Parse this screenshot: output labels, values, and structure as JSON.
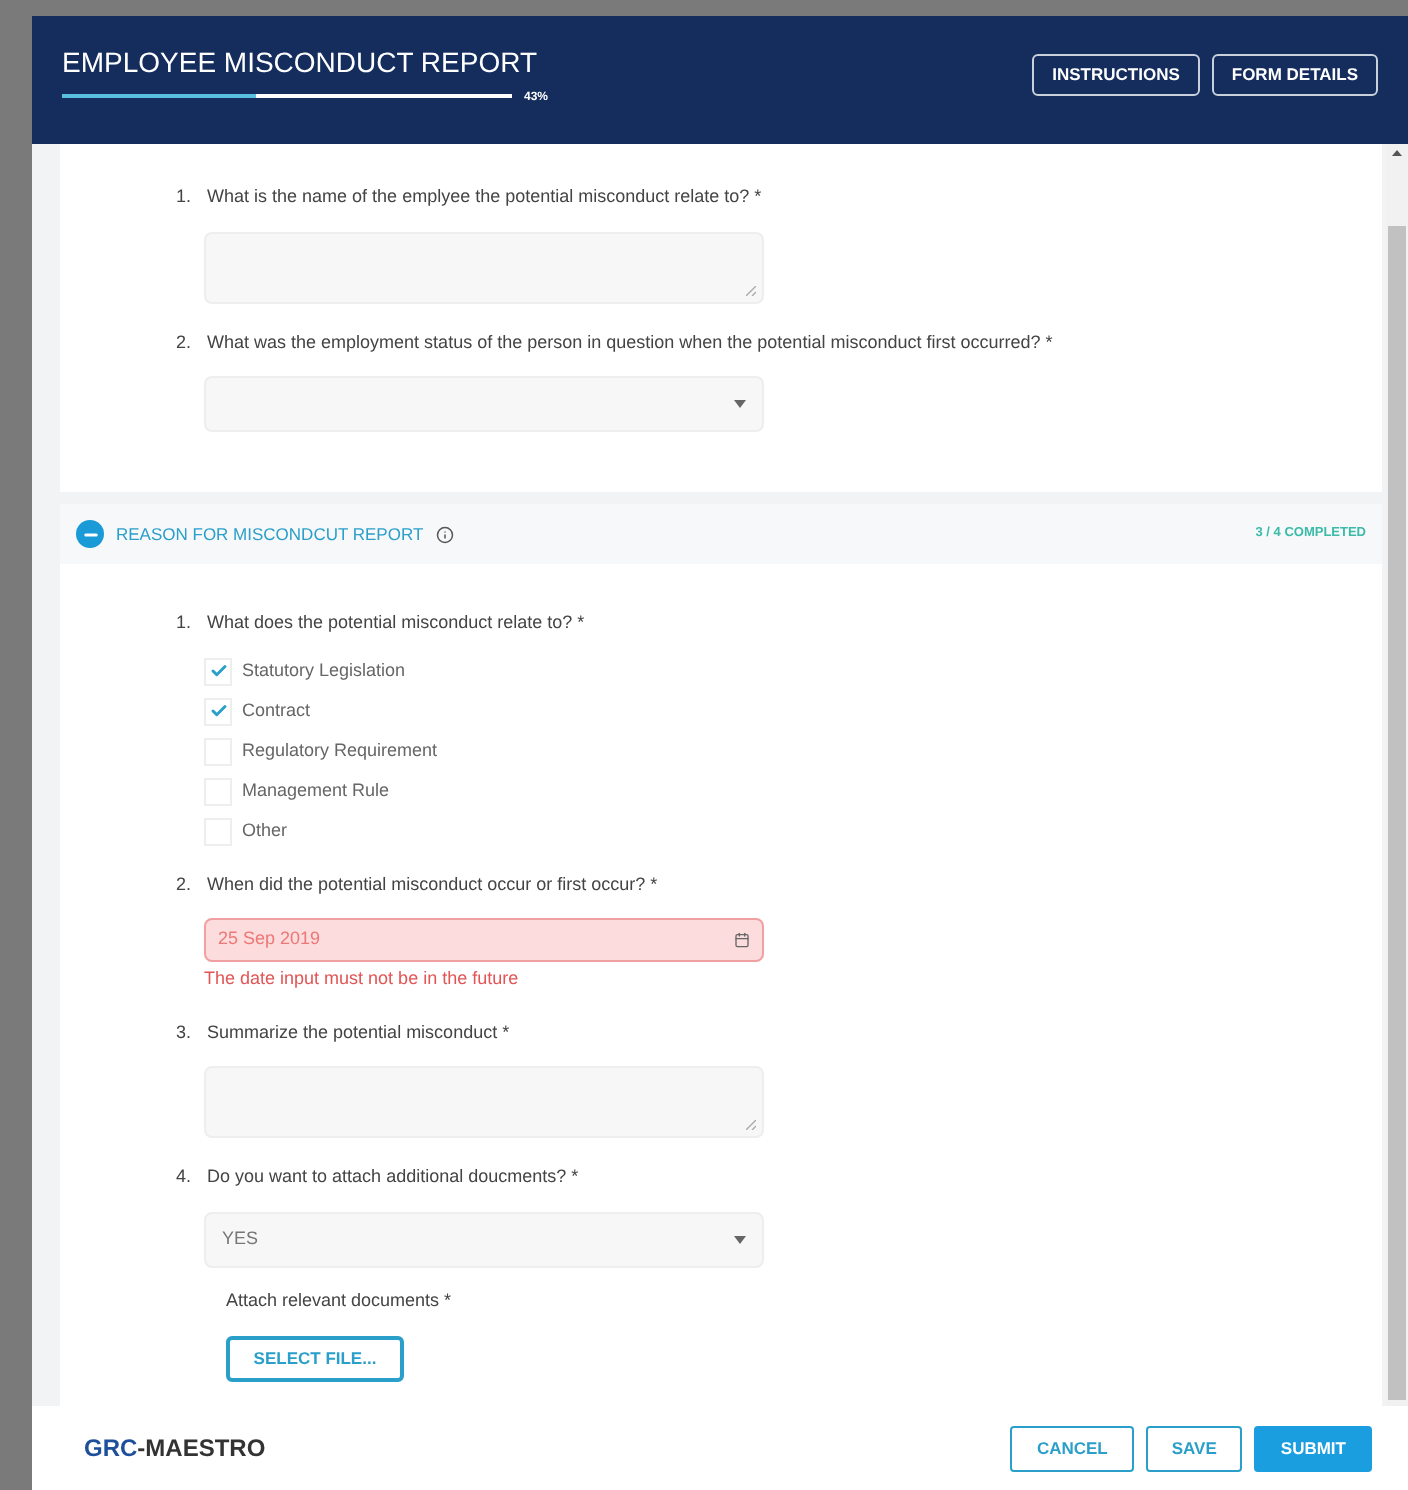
{
  "header": {
    "title": "EMPLOYEE MISCONDUCT REPORT",
    "progress": {
      "level": 0.43,
      "label": "43%"
    },
    "buttons": [
      "INSTRUCTIONS",
      "FORM DETAILS"
    ]
  },
  "sections": [
    {
      "questions": [
        {
          "number": "1.",
          "text": "What is the name of the emplyee the potential misconduct relate to? *",
          "kind": "textarea"
        },
        {
          "number": "2.",
          "text": "What was the employment status of the person in question when the potential misconduct first occurred? *",
          "kind": "select"
        }
      ]
    },
    {
      "title": "REASON FOR MISCONDCUT REPORT",
      "completion": "3 / 4 COMPLETED",
      "expanded": true,
      "questions": [
        {
          "number": "1.",
          "text": "What does the potential misconduct relate to? *",
          "kind": "checkboxes",
          "options": [
            {
              "label": "Statutory Legislation",
              "checked": true
            },
            {
              "label": "Contract",
              "checked": true
            },
            {
              "label": "Regulatory Requirement",
              "checked": false
            },
            {
              "label": "Management Rule",
              "checked": false
            },
            {
              "label": "Other",
              "checked": false
            }
          ]
        },
        {
          "number": "2.",
          "text": "When did the potential misconduct occur or first occur? *",
          "kind": "date",
          "value": "25 Sep 2019",
          "invalid": true,
          "error": "The date input must not be in the future"
        },
        {
          "number": "3.",
          "text": "Summarize the potential misconduct *",
          "kind": "textarea"
        },
        {
          "number": "4.",
          "text": "Do you want to attach additional doucments? *",
          "kind": "select",
          "value": "YES",
          "attachment": {
            "label": "Attach relevant documents *",
            "button": "SELECT FILE..."
          }
        }
      ]
    }
  ],
  "footer": {
    "logo": {
      "brand": "GRC",
      "name": "-MAESTRO"
    },
    "buttons": [
      {
        "label": "CANCEL",
        "kind": "outline"
      },
      {
        "label": "SAVE",
        "kind": "outline"
      },
      {
        "label": "SUBMIT",
        "kind": "primary"
      }
    ]
  }
}
